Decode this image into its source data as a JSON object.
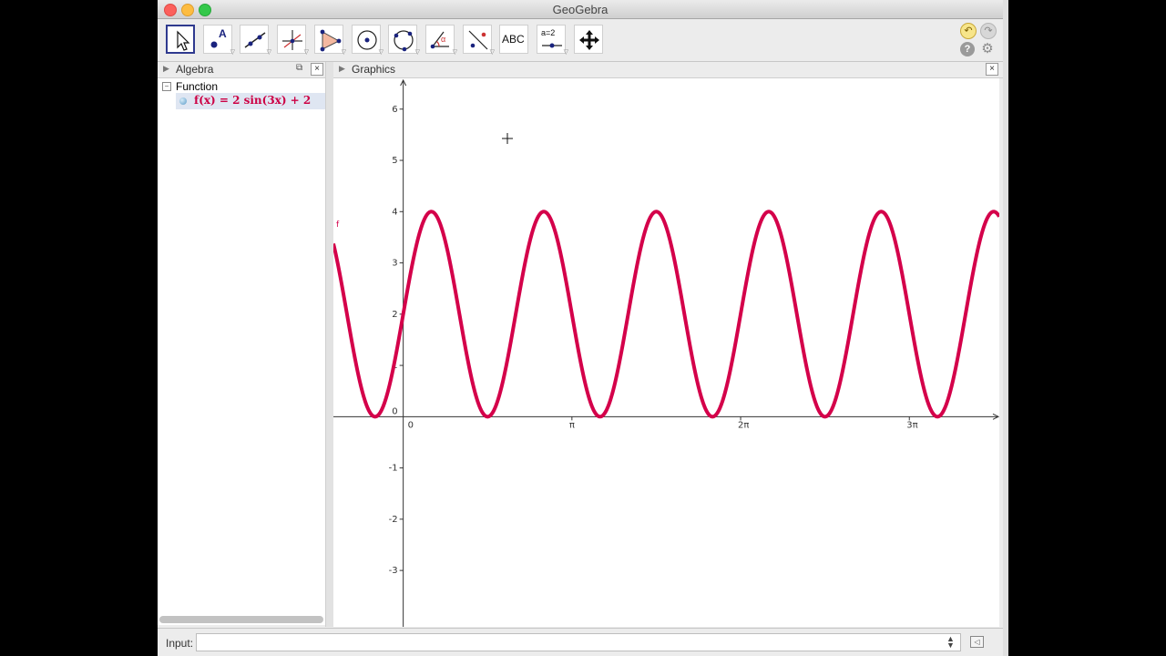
{
  "window": {
    "title": "GeoGebra"
  },
  "toolbar": {
    "tools": [
      {
        "name": "move-tool",
        "label": ""
      },
      {
        "name": "point-tool",
        "label": "A"
      },
      {
        "name": "line-tool",
        "label": ""
      },
      {
        "name": "perpendicular-line-tool",
        "label": ""
      },
      {
        "name": "polygon-tool",
        "label": ""
      },
      {
        "name": "circle-tool",
        "label": ""
      },
      {
        "name": "conic-tool",
        "label": ""
      },
      {
        "name": "angle-tool",
        "label": "α"
      },
      {
        "name": "reflect-tool",
        "label": ""
      },
      {
        "name": "text-tool",
        "label": "ABC"
      },
      {
        "name": "slider-tool",
        "label": "a=2"
      },
      {
        "name": "move-graphics-view-tool",
        "label": ""
      }
    ]
  },
  "algebra": {
    "title": "Algebra",
    "category": "Function",
    "items": [
      {
        "formula": "f(x) = 2 sin(3x) + 2"
      }
    ]
  },
  "graphics": {
    "title": "Graphics",
    "function_label": "f"
  },
  "input": {
    "label": "Input:",
    "value": "",
    "placeholder": ""
  },
  "colors": {
    "curve": "#d4004a",
    "selection": "#dfe6f2",
    "accent": "#2f3a8f"
  },
  "chart_data": {
    "type": "line",
    "series": [
      {
        "name": "f",
        "expression": "2 sin(3x) + 2",
        "amplitude": 2,
        "frequency": 3,
        "offset": 2
      }
    ],
    "xlim": [
      -1.3,
      11.1
    ],
    "ylim": [
      -4.1,
      6.6
    ],
    "x_ticks": [
      {
        "value": 0,
        "label": "0"
      },
      {
        "value": 3.14159,
        "label": "π"
      },
      {
        "value": 6.28319,
        "label": "2π"
      },
      {
        "value": 9.42478,
        "label": "3π"
      }
    ],
    "y_ticks": [
      -3,
      -2,
      -1,
      0,
      1,
      2,
      3,
      4,
      5,
      6
    ],
    "grid": false
  }
}
